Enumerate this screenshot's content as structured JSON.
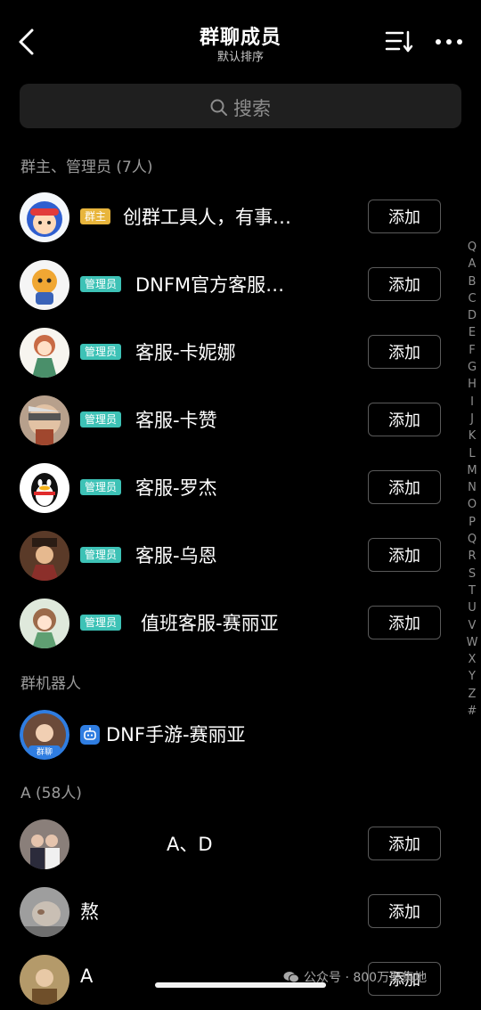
{
  "header": {
    "title": "群聊成员",
    "subtitle": "默认排序"
  },
  "search": {
    "placeholder": "搜索"
  },
  "sections": {
    "admins": "群主、管理员 (7人)",
    "robots": "群机器人",
    "a_group": "A (58人)"
  },
  "add_label": "添加",
  "admins": [
    {
      "badge": "群主",
      "name": "创群工具人，有事…"
    },
    {
      "badge": "管理员",
      "name": "DNFM官方客服…"
    },
    {
      "badge": "管理员",
      "name": "客服-卡妮娜"
    },
    {
      "badge": "管理员",
      "name": "客服-卡赞"
    },
    {
      "badge": "管理员",
      "name": "客服-罗杰"
    },
    {
      "badge": "管理员",
      "name": "客服-乌恩"
    },
    {
      "badge": "管理员",
      "name": "值班客服-赛丽亚"
    }
  ],
  "robot": {
    "name": "DNF手游-赛丽亚",
    "avatar_tag": "群聊"
  },
  "a_members": [
    {
      "name": "A、D"
    },
    {
      "name": "熬"
    },
    {
      "name": "A"
    }
  ],
  "index_letters": [
    "Q",
    "A",
    "B",
    "C",
    "D",
    "E",
    "F",
    "G",
    "H",
    "I",
    "J",
    "K",
    "L",
    "M",
    "N",
    "O",
    "P",
    "Q",
    "R",
    "S",
    "T",
    "U",
    "V",
    "W",
    "X",
    "Y",
    "Z",
    "#"
  ],
  "watermark": "公众号 · 800万聚集地",
  "colors": {
    "background": "#000000",
    "owner_badge": "#e8b53c",
    "admin_badge": "#3dc2b6",
    "robot_icon": "#2f7de1"
  }
}
